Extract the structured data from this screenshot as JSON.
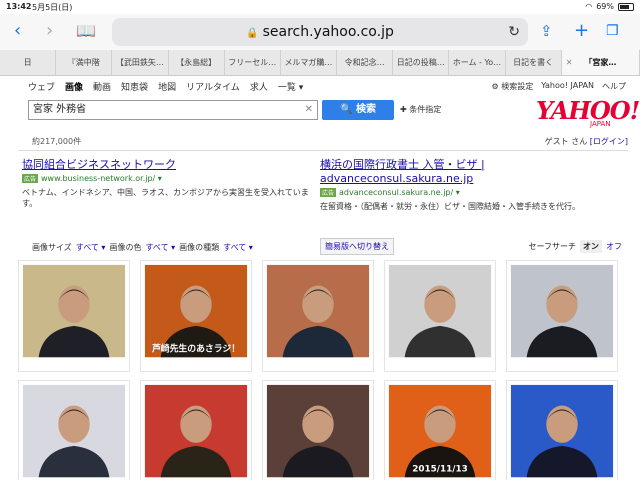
{
  "status": {
    "time": "13:42",
    "date": "5月5日(日)",
    "battery": "69%"
  },
  "browser": {
    "url": "search.yahoo.co.jp",
    "tabs": [
      "日",
      "『満中階",
      "【武田鉄矢…",
      "【永島総】",
      "フリーセル…",
      "メルマガ購…",
      "令和記念…",
      "日記の投稿…",
      "ホーム - Yo…",
      "日記を書く",
      "「宮家…"
    ]
  },
  "nav": {
    "verticals": [
      "ウェブ",
      "画像",
      "動画",
      "知恵袋",
      "地図",
      "リアルタイム",
      "求人",
      "一覧 ▾"
    ],
    "top_links": [
      "⚙ 検索設定",
      "Yahoo! JAPAN",
      "ヘルプ"
    ]
  },
  "search": {
    "query": "宮家 外務省",
    "button_label": "🔍 検索",
    "condition_label": "✚ 条件指定",
    "result_count": "約217,000件"
  },
  "logo": {
    "text": "YAHOO!",
    "sub": "JAPAN"
  },
  "user": {
    "guest": "ゲスト さん",
    "login": "[ログイン]"
  },
  "ads": [
    {
      "title": "協同組合ビジネスネットワーク",
      "badge": "広告",
      "url": "www.business-network.or.jp/ ▾",
      "desc": "ベトナム、インドネシア、中国、ラオス、カンボジアから実習生を受入れています。"
    },
    {
      "title": "横浜の国際行政書士 入管・ビザ | advanceconsul.sakura.ne.jp",
      "badge": "広告",
      "url": "advanceconsul.sakura.ne.jp/ ▾",
      "desc": "在留資格・（配偶者・就労・永住）ビザ・国際結婚・入管手続きを代行。"
    }
  ],
  "filters": {
    "size_label": "画像サイズ",
    "size_value": "すべて ▾",
    "color_label": "画像の色",
    "color_value": "すべて ▾",
    "kind_label": "画像の種類",
    "kind_value": "すべて ▾",
    "switch_label": "簡易版へ切り替え",
    "safe_label": "セーフサーチ",
    "safe_on": "オン",
    "safe_off": "オフ"
  },
  "thumbs": [
    {
      "caption": "",
      "colors": [
        "#c9b98a",
        "#1f1f28"
      ]
    },
    {
      "caption": "芦崎先生のあさラジ！",
      "colors": [
        "#c45a1a",
        "#201a14"
      ]
    },
    {
      "caption": "",
      "colors": [
        "#b86d4a",
        "#1d2838"
      ]
    },
    {
      "caption": "",
      "colors": [
        "#d0d0d0",
        "#303030"
      ]
    },
    {
      "caption": "",
      "colors": [
        "#bfc4cc",
        "#1a1c22"
      ]
    },
    {
      "caption": "",
      "colors": [
        "#d8d8e0",
        "#2a2f3e"
      ]
    },
    {
      "caption": "",
      "colors": [
        "#c63a2f",
        "#2a2418"
      ]
    },
    {
      "caption": "",
      "colors": [
        "#5a4038",
        "#1a1a20"
      ]
    },
    {
      "caption": "2015/11/13",
      "colors": [
        "#e0601a",
        "#1a1410"
      ]
    },
    {
      "caption": "",
      "colors": [
        "#2a5ac8",
        "#15182a"
      ]
    }
  ]
}
